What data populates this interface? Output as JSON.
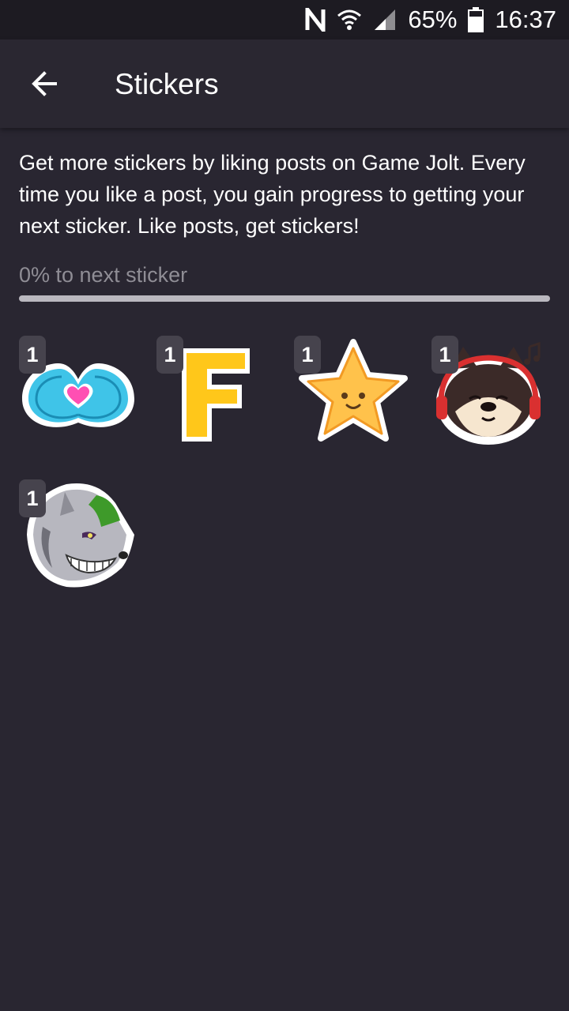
{
  "status_bar": {
    "battery": "65%",
    "time": "16:37",
    "icons": [
      "nfc-icon",
      "wifi-icon",
      "signal-icon",
      "battery-icon"
    ]
  },
  "app_bar": {
    "back_icon": "arrow-left-icon",
    "title": "Stickers"
  },
  "intro": {
    "text": "Get more stickers by liking posts on Game Jolt. Every time you like a post, you gain progress to getting your next sticker. Like posts, get stickers!"
  },
  "progress": {
    "label": "0% to next sticker",
    "value": 0
  },
  "stickers": [
    {
      "name": "heart-hands-sticker",
      "count": "1"
    },
    {
      "name": "letter-f-sticker",
      "count": "1"
    },
    {
      "name": "smiling-star-sticker",
      "count": "1"
    },
    {
      "name": "dog-headphones-sticker",
      "count": "1"
    },
    {
      "name": "grinning-wolf-sticker",
      "count": "1"
    }
  ],
  "colors": {
    "background": "#292631",
    "status_bar": "#1d1b22",
    "progress_track": "#bab8bf",
    "muted_text": "#8f8d95",
    "badge": "#46434d"
  }
}
